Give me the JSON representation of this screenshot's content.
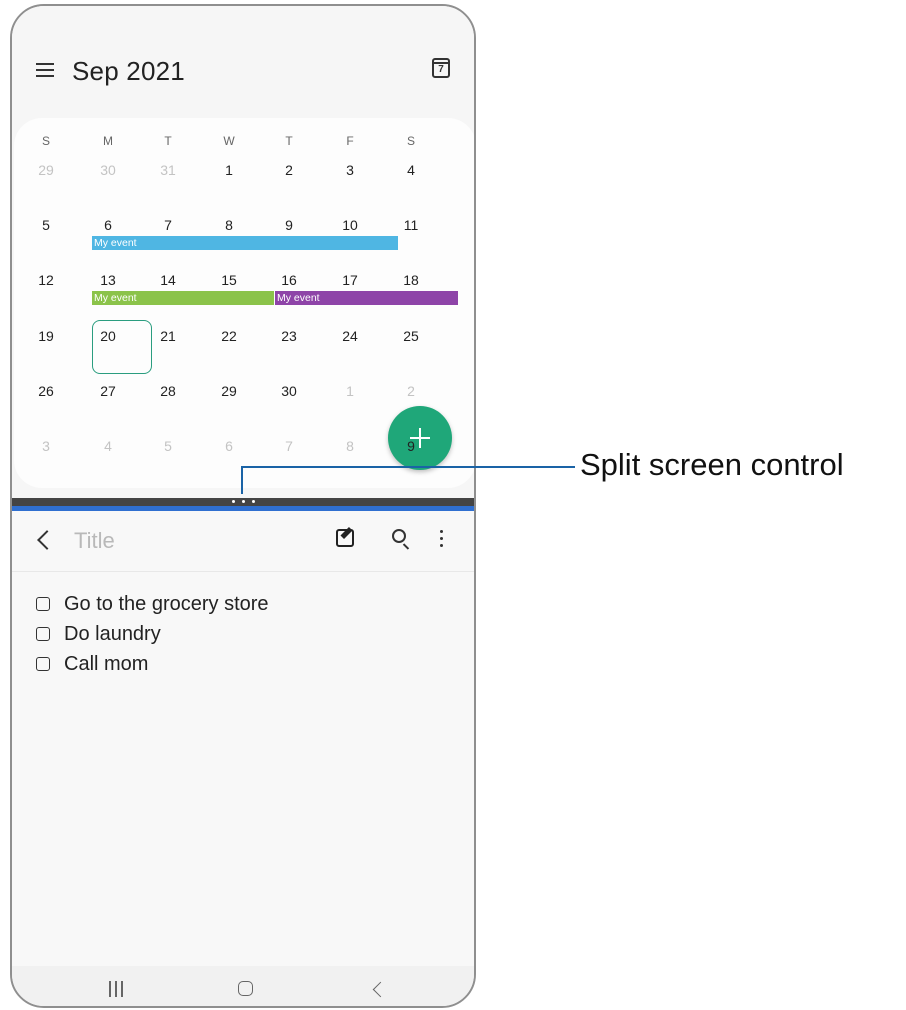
{
  "calendar": {
    "month_title": "Sep 2021",
    "today_icon_number": "7",
    "weekdays": [
      "S",
      "M",
      "T",
      "W",
      "T",
      "F",
      "S"
    ],
    "weeks": [
      [
        "29",
        "30",
        "31",
        "1",
        "2",
        "3",
        "4"
      ],
      [
        "5",
        "6",
        "7",
        "8",
        "9",
        "10",
        "11"
      ],
      [
        "12",
        "13",
        "14",
        "15",
        "16",
        "17",
        "18"
      ],
      [
        "19",
        "20",
        "21",
        "22",
        "23",
        "24",
        "25"
      ],
      [
        "26",
        "27",
        "28",
        "29",
        "30",
        "1",
        "2"
      ],
      [
        "3",
        "4",
        "5",
        "6",
        "7",
        "8",
        "9"
      ]
    ],
    "muted_cells": [
      [
        0,
        0
      ],
      [
        0,
        1
      ],
      [
        0,
        2
      ],
      [
        4,
        5
      ],
      [
        4,
        6
      ],
      [
        5,
        0
      ],
      [
        5,
        1
      ],
      [
        5,
        2
      ],
      [
        5,
        3
      ],
      [
        5,
        4
      ],
      [
        5,
        5
      ]
    ],
    "selected_date": "20",
    "events": [
      {
        "label": "My event",
        "color": "#4fb6e3"
      },
      {
        "label": "My event",
        "color": "#8bc34a"
      },
      {
        "label": "My event",
        "color": "#8e44a8"
      }
    ],
    "fab_label": "+"
  },
  "notes": {
    "title_placeholder": "Title",
    "items": [
      "Go to the grocery store",
      "Do laundry",
      "Call mom"
    ]
  },
  "callout": {
    "label": "Split screen control"
  },
  "colors": {
    "accent_green": "#1fa779",
    "divider_blue": "#2f6fd0",
    "callout_line": "#1a63a6"
  }
}
